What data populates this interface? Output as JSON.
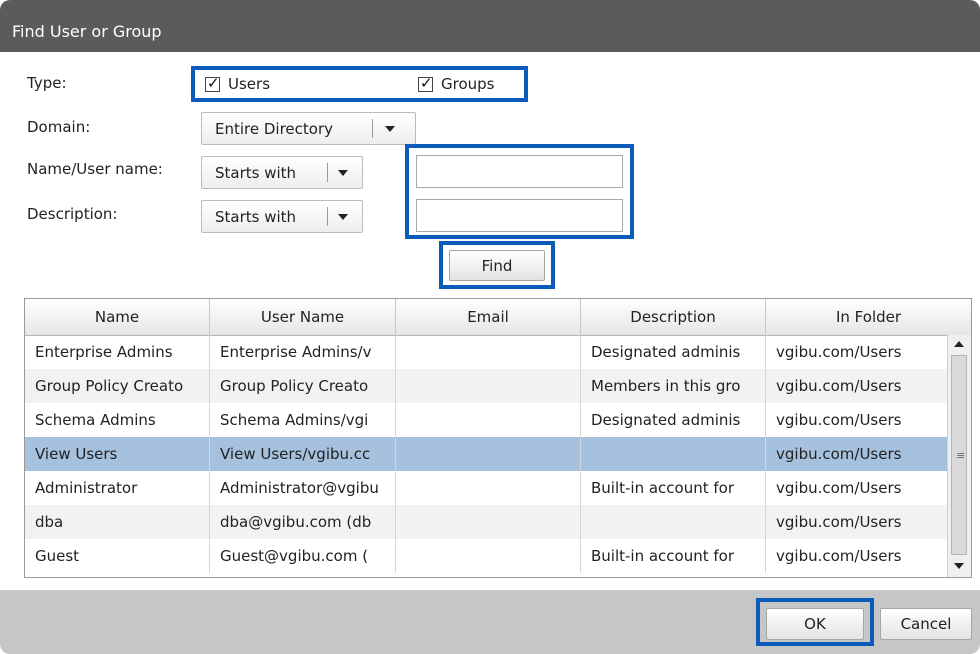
{
  "window": {
    "title": "Find User or Group"
  },
  "form": {
    "type_label": "Type:",
    "type_options": [
      {
        "label": "Users",
        "checked": true
      },
      {
        "label": "Groups",
        "checked": true
      }
    ],
    "domain_label": "Domain:",
    "domain_value": "Entire Directory",
    "name_label": "Name/User name:",
    "name_match": "Starts with",
    "name_value": "",
    "description_label": "Description:",
    "description_match": "Starts with",
    "description_value": "",
    "find_label": "Find"
  },
  "table": {
    "columns": [
      "Name",
      "User Name",
      "Email",
      "Description",
      "In Folder"
    ],
    "rows": [
      {
        "name": "Enterprise Admins",
        "user_name": "Enterprise Admins/v",
        "email": "",
        "description": "Designated adminis",
        "folder": "vgibu.com/Users"
      },
      {
        "name": "Group Policy Creato",
        "user_name": "Group Policy Creato",
        "email": "",
        "description": "Members in this gro",
        "folder": "vgibu.com/Users"
      },
      {
        "name": "Schema Admins",
        "user_name": "Schema Admins/vgi",
        "email": "",
        "description": "Designated adminis",
        "folder": "vgibu.com/Users"
      },
      {
        "name": "View Users",
        "user_name": "View Users/vgibu.cc",
        "email": "",
        "description": "",
        "folder": "vgibu.com/Users",
        "selected": true
      },
      {
        "name": "Administrator",
        "user_name": "Administrator@vgibu",
        "email": "",
        "description": "Built-in account for",
        "folder": "vgibu.com/Users"
      },
      {
        "name": "dba",
        "user_name": "dba@vgibu.com (db",
        "email": "",
        "description": "",
        "folder": "vgibu.com/Users"
      },
      {
        "name": "Guest",
        "user_name": "Guest@vgibu.com (",
        "email": "",
        "description": "Built-in account for",
        "folder": "vgibu.com/Users"
      }
    ]
  },
  "buttons": {
    "ok": "OK",
    "cancel": "Cancel"
  },
  "colors": {
    "titlebar": "#5b5b5b",
    "highlight": "#0a5cb8",
    "selected_row": "#a6c1dd",
    "footer": "#c6c6c6"
  }
}
